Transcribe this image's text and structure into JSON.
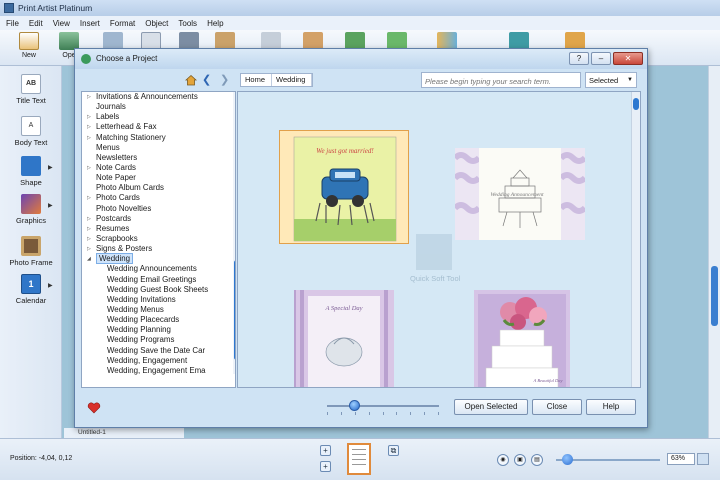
{
  "app": {
    "title": "Print Artist Platinum"
  },
  "menu": [
    "File",
    "Edit",
    "View",
    "Insert",
    "Format",
    "Object",
    "Tools",
    "Help"
  ],
  "toolbar": {
    "new_label": "New",
    "open_label": "Ope"
  },
  "left_panel": [
    {
      "label": "Title Text",
      "icon": "title-text-icon",
      "has_arrow": false
    },
    {
      "label": "Body Text",
      "icon": "body-text-icon",
      "has_arrow": false
    },
    {
      "label": "Shape",
      "icon": "shape-icon",
      "has_arrow": true
    },
    {
      "label": "Graphics",
      "icon": "graphics-icon",
      "has_arrow": true
    },
    {
      "label": "Photo Frame",
      "icon": "photo-frame-icon",
      "has_arrow": false
    },
    {
      "label": "Calendar",
      "icon": "calendar-icon",
      "has_arrow": true
    }
  ],
  "dialog": {
    "title": "Choose a Project",
    "breadcrumb": [
      "Home",
      "Wedding"
    ],
    "search_placeholder": "Please begin typing your search term.",
    "search_scope": "Selected",
    "tree": [
      {
        "label": "Invitations & Announcements",
        "expandable": true
      },
      {
        "label": "Journals",
        "expandable": false
      },
      {
        "label": "Labels",
        "expandable": true
      },
      {
        "label": "Letterhead & Fax",
        "expandable": true
      },
      {
        "label": "Matching Stationery",
        "expandable": true
      },
      {
        "label": "Menus",
        "expandable": false
      },
      {
        "label": "Newsletters",
        "expandable": false
      },
      {
        "label": "Note Cards",
        "expandable": true
      },
      {
        "label": "Note Paper",
        "expandable": false
      },
      {
        "label": "Photo Album Cards",
        "expandable": false
      },
      {
        "label": "Photo Cards",
        "expandable": true
      },
      {
        "label": "Photo Novelties",
        "expandable": false
      },
      {
        "label": "Postcards",
        "expandable": true
      },
      {
        "label": "Resumes",
        "expandable": true
      },
      {
        "label": "Scrapbooks",
        "expandable": true
      },
      {
        "label": "Signs & Posters",
        "expandable": true
      },
      {
        "label": "Wedding",
        "expanded": true,
        "selected": true
      },
      {
        "label": "Wedding Announcements",
        "child": true
      },
      {
        "label": "Wedding Email Greetings",
        "child": true
      },
      {
        "label": "Wedding Guest Book Sheets",
        "child": true
      },
      {
        "label": "Wedding Invitations",
        "child": true
      },
      {
        "label": "Wedding Menus",
        "child": true
      },
      {
        "label": "Wedding Placecards",
        "child": true
      },
      {
        "label": "Wedding Planning",
        "child": true
      },
      {
        "label": "Wedding Programs",
        "child": true
      },
      {
        "label": "Wedding Save the Date Car",
        "child": true
      },
      {
        "label": "Wedding, Engagement",
        "child": true
      },
      {
        "label": "Wedding, Engagement Ema",
        "child": true
      }
    ],
    "card1_text": "We just got married!",
    "card2_text": "Wedding Announcement",
    "card3_text": "A Special Day",
    "card4_text": "A Beautiful Day",
    "watermark": "Quick Soft Tool",
    "buttons": {
      "open": "Open Selected",
      "close": "Close",
      "help": "Help"
    },
    "window_controls": {
      "help": "?",
      "minimize": "–",
      "close": "✕"
    }
  },
  "doc_tab": {
    "label": "Untitled-1"
  },
  "status": {
    "position": "Position: -4,04, 0,12",
    "zoom": "63%"
  },
  "colors": {
    "accent": "#2d78d0",
    "selected_card": "#e1a04a"
  }
}
